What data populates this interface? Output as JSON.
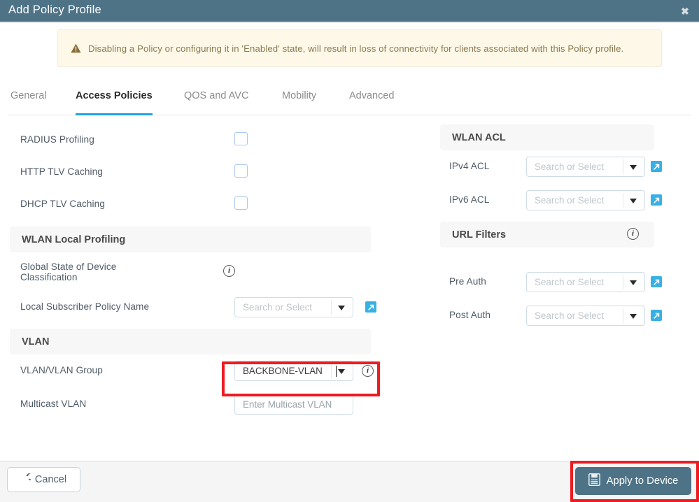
{
  "window": {
    "title": "Add Policy Profile",
    "close_label": "✖"
  },
  "warning": {
    "icon": "warning-triangle-icon",
    "text": "Disabling a Policy or configuring it in 'Enabled' state, will result in loss of connectivity for clients associated with this Policy profile."
  },
  "tabs": [
    {
      "label": "General",
      "active": false
    },
    {
      "label": "Access Policies",
      "active": true
    },
    {
      "label": "QOS and AVC",
      "active": false
    },
    {
      "label": "Mobility",
      "active": false
    },
    {
      "label": "Advanced",
      "active": false
    }
  ],
  "left": {
    "checkbox_rows": [
      {
        "label": "RADIUS Profiling",
        "checked": false
      },
      {
        "label": "HTTP TLV Caching",
        "checked": false
      },
      {
        "label": "DHCP TLV Caching",
        "checked": false
      }
    ],
    "wlan_local_profiling": {
      "section_title": "WLAN Local Profiling",
      "global_state_label": "Global State of Device Classification",
      "local_subscriber_label": "Local Subscriber Policy Name",
      "local_subscriber_placeholder": "Search or Select"
    },
    "vlan": {
      "section_title": "VLAN",
      "vlan_group_label": "VLAN/VLAN Group",
      "vlan_group_value": "BACKBONE-VLAN",
      "multicast_label": "Multicast VLAN",
      "multicast_placeholder": "Enter Multicast VLAN"
    }
  },
  "right": {
    "wlan_acl": {
      "section_title": "WLAN ACL",
      "ipv4_label": "IPv4 ACL",
      "ipv4_placeholder": "Search or Select",
      "ipv6_label": "IPv6 ACL",
      "ipv6_placeholder": "Search or Select"
    },
    "url_filters": {
      "section_title": "URL Filters",
      "pre_auth_label": "Pre Auth",
      "pre_auth_placeholder": "Search or Select",
      "post_auth_label": "Post Auth",
      "post_auth_placeholder": "Search or Select"
    }
  },
  "footer": {
    "cancel_label": "Cancel",
    "cancel_icon": "undo-arrow-icon",
    "apply_label": "Apply to Device",
    "apply_icon": "save-floppy-icon"
  },
  "colors": {
    "titlebar_bg": "#4e7286",
    "accent_tab": "#1ea2e0",
    "warning_bg": "#fdf8e7",
    "warning_text": "#8a7a52",
    "section_bg": "#f7f7f7",
    "extlink_blue": "#39b0e3",
    "annotation_red": "#ee1c21",
    "apply_button_bg": "#4e7286"
  }
}
